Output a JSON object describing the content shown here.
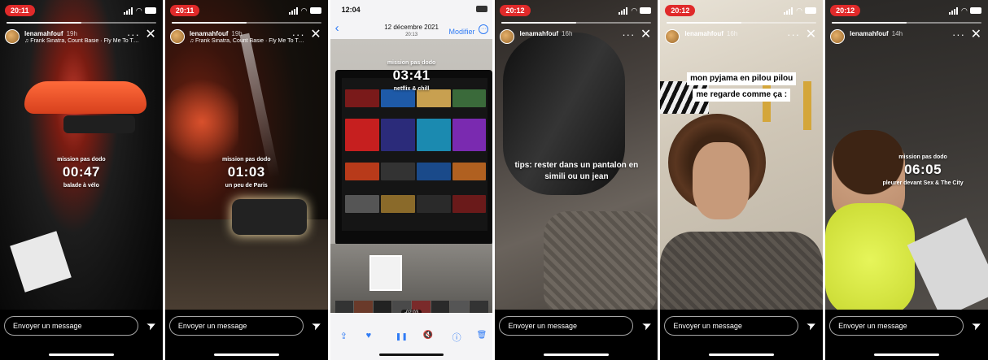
{
  "common": {
    "message_placeholder": "Envoyer un message",
    "close_glyph": "✕",
    "more_glyph": "···",
    "send_glyph": "➤"
  },
  "stories": [
    {
      "time": "20:11",
      "username": "lenamahfouf",
      "age": "19h",
      "music": "♫ Frank Sinatra, Count Basie · Fly Me To T… ›",
      "progress": 0.5,
      "overlay_label": "mission pas dodo",
      "overlay_time": "00:47",
      "overlay_caption": "balade à vélo"
    },
    {
      "time": "20:11",
      "username": "lenamahfouf",
      "age": "19h",
      "music": "♫ Frank Sinatra, Count Basie · Fly Me To T… ›",
      "progress": 0.5,
      "overlay_label": "mission pas dodo",
      "overlay_time": "01:03",
      "overlay_caption": "un peu de Paris"
    },
    {
      "time": "20:12",
      "username": "lenamahfouf",
      "age": "16h",
      "progress": 0.5,
      "text": "tips: rester dans un pantalon en simili ou un jean"
    },
    {
      "time": "20:12",
      "username": "lenamahfouf",
      "age": "16h",
      "progress": 0.5,
      "text_lines": [
        "mon pyjama en pilou pilou",
        "me regarde comme ça :"
      ]
    },
    {
      "time": "20:12",
      "username": "lenamahfouf",
      "age": "14h",
      "progress": 0.5,
      "overlay_label": "mission pas dodo",
      "overlay_time": "06:05",
      "overlay_caption": "pleurer devant Sex & The City"
    }
  ],
  "photo": {
    "time": "12:04",
    "date": "12 décembre 2021",
    "subtime": "20:13",
    "back_glyph": "‹",
    "edit_label": "Modifier",
    "more_glyph": "···",
    "overlay_label": "mission pas dodo",
    "overlay_time": "03:41",
    "overlay_caption": "netflix & chill",
    "duration": "-02:03",
    "toolbar": {
      "share_glyph": "⇪",
      "heart_glyph": "♥",
      "pause_glyph": "❚❚",
      "mute_glyph": "🔇",
      "info_glyph": "ⓘ",
      "trash_glyph": "🗑"
    }
  }
}
